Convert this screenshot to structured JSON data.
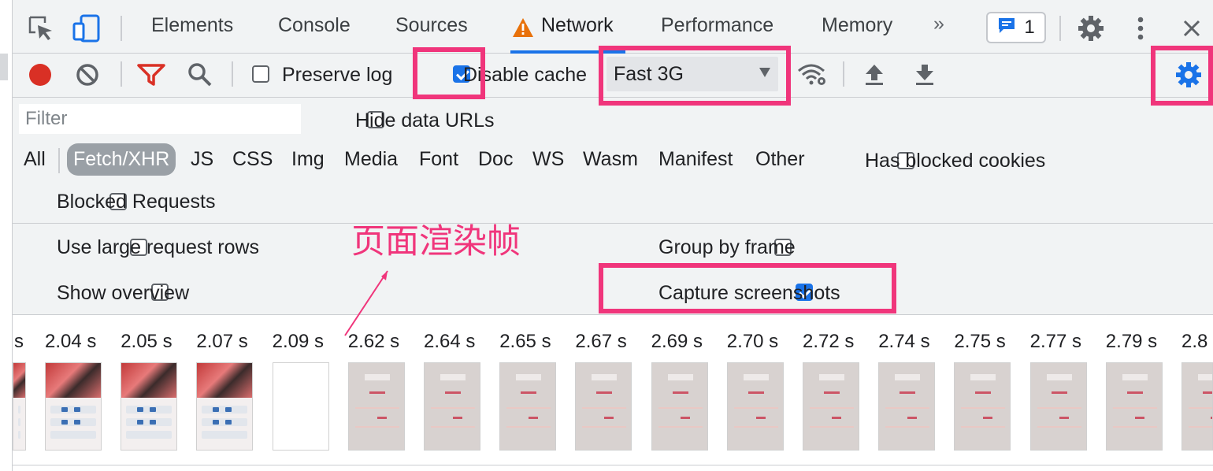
{
  "tabs": [
    "Elements",
    "Console",
    "Sources",
    "Network",
    "Performance",
    "Memory"
  ],
  "active_tab": "Network",
  "more_tabs_glyph": "»",
  "issues": {
    "count": "1"
  },
  "toolbar": {
    "preserve_log": {
      "label": "Preserve log",
      "checked": false
    },
    "disable_cache": {
      "label": "Disable cache",
      "checked": true
    },
    "throttling": "Fast 3G"
  },
  "filter": {
    "placeholder": "Filter",
    "hide_data_urls": {
      "label": "Hide data URLs",
      "checked": false
    },
    "types": [
      "All",
      "Fetch/XHR",
      "JS",
      "CSS",
      "Img",
      "Media",
      "Font",
      "Doc",
      "WS",
      "Wasm",
      "Manifest",
      "Other"
    ],
    "selected_type": "Fetch/XHR",
    "has_blocked_cookies": {
      "label": "Has blocked cookies",
      "checked": false
    },
    "blocked_requests": {
      "label": "Blocked Requests",
      "checked": false
    }
  },
  "settings": {
    "large_rows": {
      "label": "Use large request rows",
      "checked": false
    },
    "show_overview": {
      "label": "Show overview",
      "checked": false
    },
    "group_by_frame": {
      "label": "Group by frame",
      "checked": false
    },
    "capture_screenshots": {
      "label": "Capture screenshots",
      "checked": true
    }
  },
  "annotation": "页面渲染帧",
  "highlight_color": "#f0357b",
  "accent_color": "#1a73e8",
  "filmstrip": {
    "times": [
      "s",
      "2.04 s",
      "2.05 s",
      "2.07 s",
      "2.09 s",
      "2.62 s",
      "2.64 s",
      "2.65 s",
      "2.67 s",
      "2.69 s",
      "2.70 s",
      "2.72 s",
      "2.74 s",
      "2.75 s",
      "2.77 s",
      "2.79 s",
      "2.8"
    ],
    "frame_kinds": [
      "photo",
      "photo",
      "photo",
      "photo",
      "blank",
      "grey",
      "grey",
      "grey",
      "grey",
      "grey",
      "grey",
      "grey",
      "grey",
      "grey",
      "grey",
      "grey",
      "grey"
    ]
  }
}
